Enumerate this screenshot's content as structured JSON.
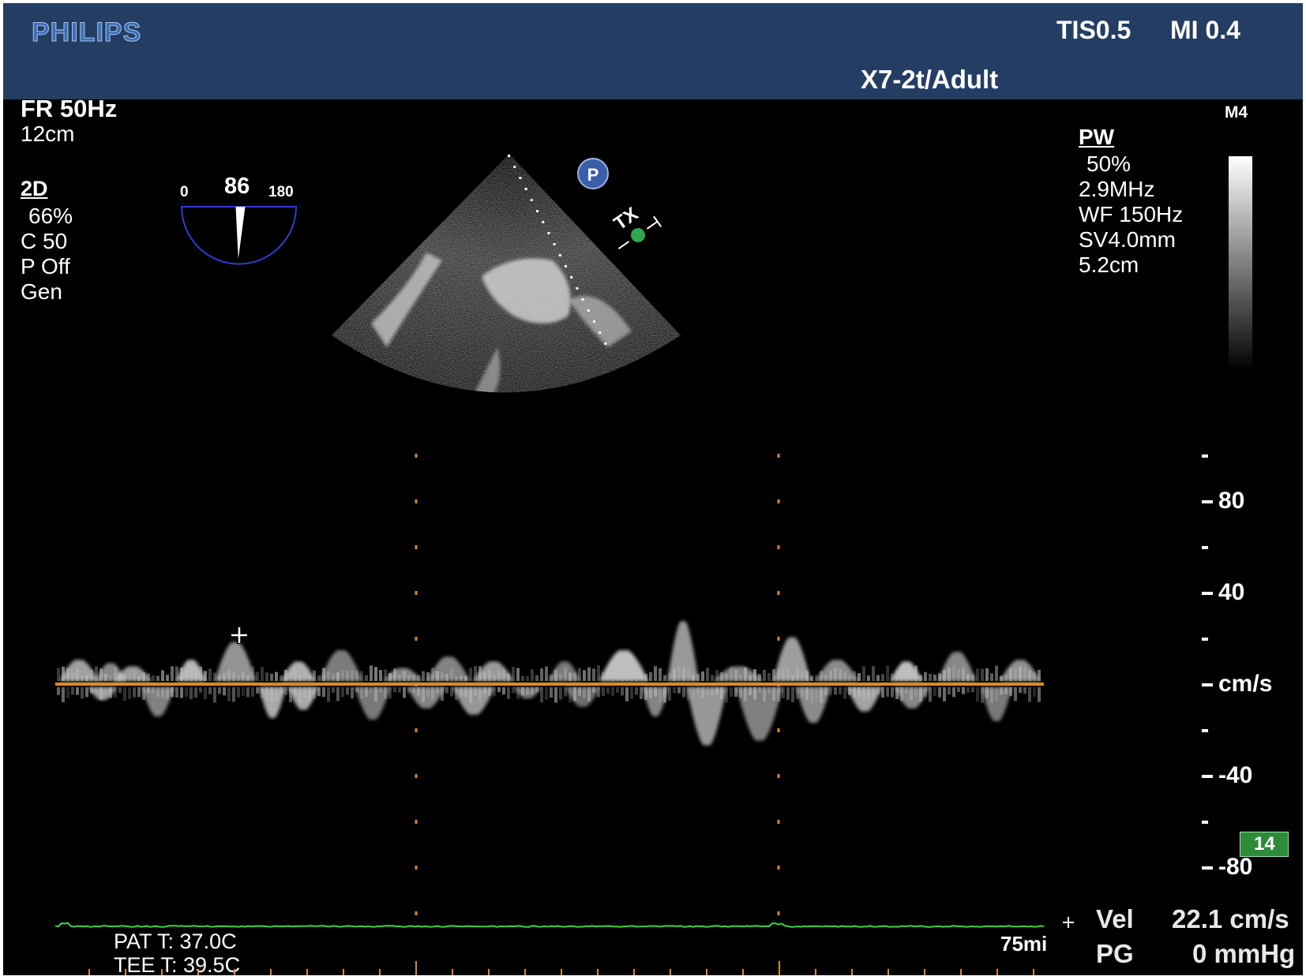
{
  "header": {
    "brand": "PHILIPS",
    "tis": "TIS0.5",
    "mi": "MI 0.4",
    "probe": "X7-2t/Adult"
  },
  "left_panel": {
    "frame_rate": "FR 50Hz",
    "depth": "12cm",
    "mode": "2D",
    "gain": "66%",
    "compression": "C 50",
    "persistence": "P Off",
    "preset": "Gen"
  },
  "omniplane": {
    "angle": "86",
    "min": "0",
    "max": "180",
    "angle_deg": 86
  },
  "markers": {
    "p_icon": "P",
    "tx_label": "TX"
  },
  "right_panel": {
    "map": "M4",
    "mode": "PW",
    "gain": "50%",
    "frequency": "2.9MHz",
    "wall_filter": "WF 150Hz",
    "sample_volume": "SV4.0mm",
    "depth": "5.2cm"
  },
  "scale": {
    "labels": [
      "80",
      "40",
      "cm/s",
      "-40",
      "-80"
    ],
    "badge": "14",
    "sweep": "75mi"
  },
  "temps": {
    "patient": "PAT T: 37.0C",
    "probe": "TEE T: 39.5C"
  },
  "measurement": {
    "vel_label": "Vel",
    "vel_value": "22.1 cm/s",
    "pg_label": "PG",
    "pg_value": "0 mmHg",
    "cursor_icon": "crosshair-icon"
  },
  "colors": {
    "header": "#243d63",
    "baseline": "#d98a2a",
    "ecg": "#3fd43f",
    "badge": "#2e8b3a"
  }
}
